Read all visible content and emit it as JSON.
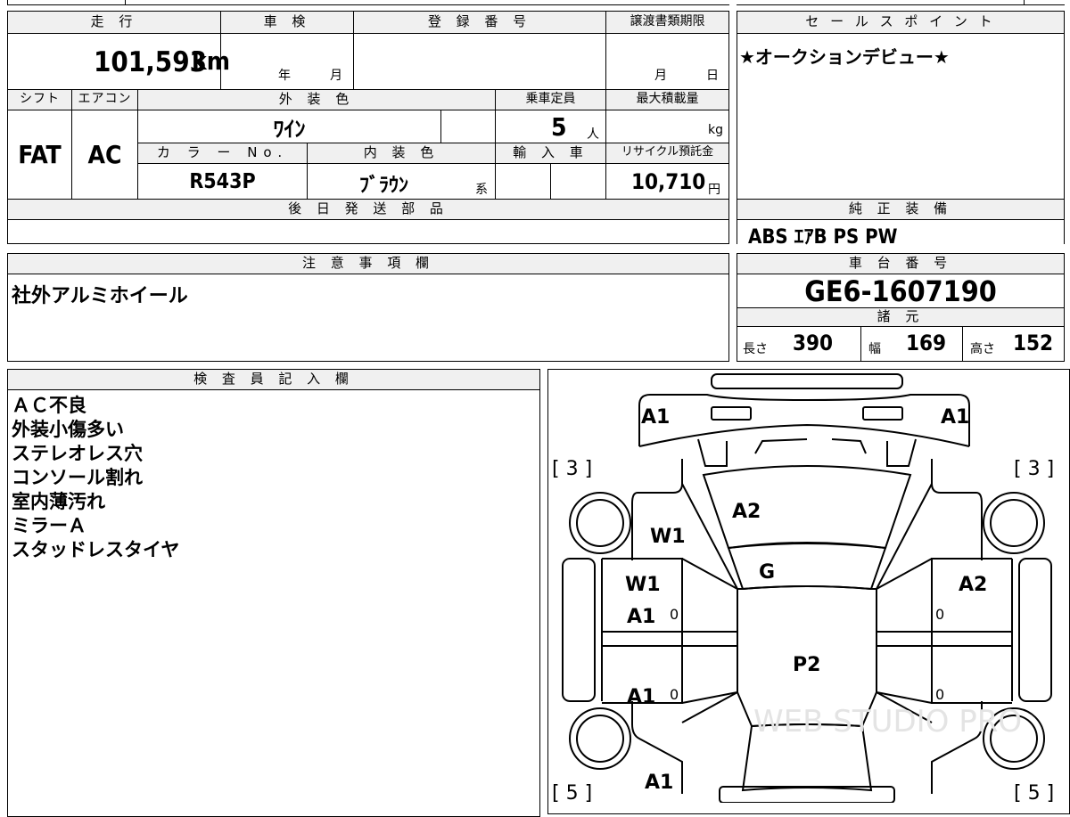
{
  "mileage": {
    "label": "走 行",
    "value": "101,593",
    "unit": "km"
  },
  "inspection": {
    "label": "車 検",
    "year": "年",
    "month": "月"
  },
  "registration": {
    "label": "登 録 番 号",
    "value": ""
  },
  "transfer_deadline": {
    "label": "譲渡書類期限",
    "month": "月",
    "day": "日"
  },
  "sales_point": {
    "label": "セ ー ル ス ポ イ ン ト",
    "text": "★オークションデビュー★"
  },
  "shift": {
    "label": "シフト",
    "value": "FAT"
  },
  "aircon": {
    "label": "エアコン",
    "value": "AC"
  },
  "exterior_color": {
    "label": "外 装 色",
    "value": "ﾜｲﾝ"
  },
  "capacity": {
    "label": "乗車定員",
    "value": "5",
    "unit": "人"
  },
  "max_load": {
    "label": "最大積載量",
    "unit": "kg"
  },
  "color_no": {
    "label": "カ ラ ー No.",
    "value": "R543P"
  },
  "interior_color": {
    "label": "内 装 色",
    "value": "ﾌﾞﾗｳﾝ",
    "suffix": "系"
  },
  "import_car": {
    "label": "輸 入 車"
  },
  "recycle_fee": {
    "label": "リサイクル預託金",
    "value": "10,710",
    "unit": "円"
  },
  "later_parts": {
    "label": "後 日 発 送 部 品",
    "text": ""
  },
  "standard_equipment": {
    "label": "純 正 装 備",
    "text": "ABS ｴｱB PS PW"
  },
  "notes": {
    "label": "注 意 事 項 欄",
    "text": "社外アルミホイール"
  },
  "chassis_number": {
    "label": "車 台 番 号",
    "value": "GE6-1607190"
  },
  "specs": {
    "label": "諸 元",
    "length_label": "長さ",
    "length": "390",
    "width_label": "幅",
    "width": "169",
    "height_label": "高さ",
    "height": "152"
  },
  "inspector": {
    "label": "検 査 員 記 入 欄",
    "lines": [
      "ＡＣ不良",
      "外装小傷多い",
      "ステレオレス穴",
      "コンソール割れ",
      "室内薄汚れ",
      "ミラーＡ",
      "スタッドレスタイヤ"
    ]
  },
  "damage_map": {
    "marks": [
      "A1",
      "A1",
      "[ 3 ]",
      "[ 3 ]",
      "A2",
      "W1",
      "G",
      "W1",
      "A2",
      "A1",
      "0",
      "0",
      "P2",
      "A1",
      "0",
      "0",
      "A1",
      "[ 5 ]",
      "[ 5 ]"
    ],
    "watermark": "WEB STUDIO PRO"
  }
}
